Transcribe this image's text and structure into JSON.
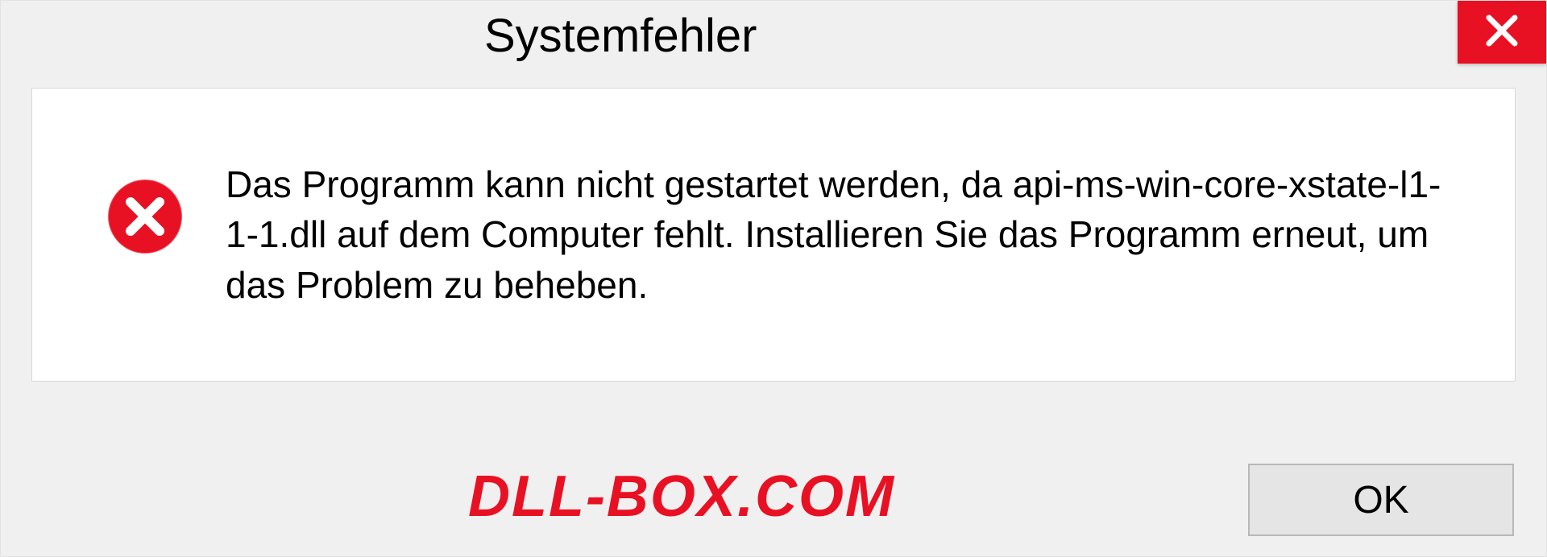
{
  "dialog": {
    "title": "Systemfehler",
    "message": "Das Programm kann nicht gestartet werden, da api-ms-win-core-xstate-l1-1-1.dll auf dem Computer fehlt. Installieren Sie das Programm erneut, um das Problem zu beheben.",
    "ok_label": "OK"
  },
  "watermark": "DLL-BOX.COM",
  "colors": {
    "close_bg": "#e81123",
    "error_icon": "#e81123",
    "watermark": "#e81123"
  }
}
